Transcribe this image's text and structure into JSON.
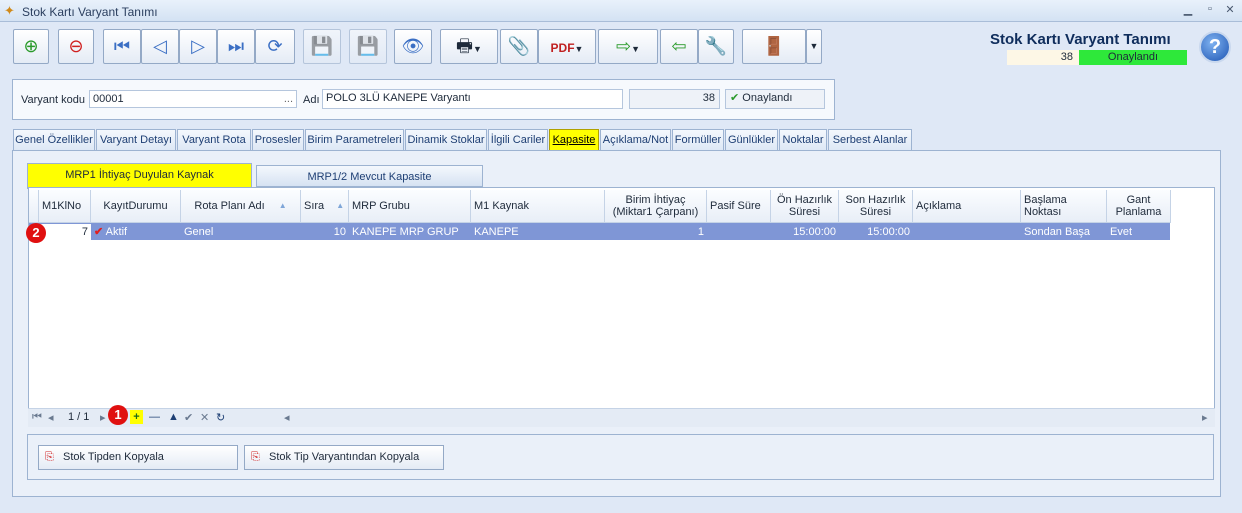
{
  "window": {
    "title": "Stok Kartı Varyant Tanımı"
  },
  "header": {
    "title": "Stok Kartı Varyant Tanımı",
    "number": "38",
    "status": "Onaylandı",
    "status_color": "#2ee83a"
  },
  "form": {
    "code_label": "Varyant kodu",
    "code_value": "00001",
    "code_ellipsis": "...",
    "name_label": "Adı",
    "name_value": "POLO 3LÜ KANEPE Varyantı",
    "count": "38",
    "approved": "Onaylandı"
  },
  "tabs": [
    "Genel Özellikler",
    "Varyant Detayı",
    "Varyant Rota",
    "Prosesler",
    "Birim Parametreleri",
    "Dinamik Stoklar",
    "İlgili Cariler",
    "Kapasite",
    "Açıklama/Not",
    "Formüller",
    "Günlükler",
    "Noktalar",
    "Serbest Alanlar"
  ],
  "subtabs": [
    "MRP1 İhtiyaç Duyulan Kaynak",
    "MRP1/2 Mevcut Kapasite"
  ],
  "grid": {
    "columns": [
      "M1KlNo",
      "KayıtDurumu",
      "Rota Planı Adı",
      "Sıra",
      "MRP Grubu",
      "M1 Kaynak",
      "Birim İhtiyaç (Miktar1 Çarpanı)",
      "Pasif Süre",
      "Ön Hazırlık Süresi",
      "Son Hazırlık Süresi",
      "Açıklama",
      "Başlama Noktası",
      "Gant Planlama"
    ],
    "rows": [
      [
        "7",
        "Aktif",
        "Genel",
        "10",
        "KANEPE MRP GRUP",
        "KANEPE",
        "1",
        "",
        "15:00:00",
        "15:00:00",
        "",
        "Sondan Başa",
        "Evet"
      ]
    ]
  },
  "nav": {
    "page": "1 / 1"
  },
  "markers": {
    "one": "1",
    "two": "2"
  },
  "buttons": {
    "copy_type": "Stok Tipden Kopyala",
    "copy_variant": "Stok Tip Varyantından Kopyala"
  }
}
